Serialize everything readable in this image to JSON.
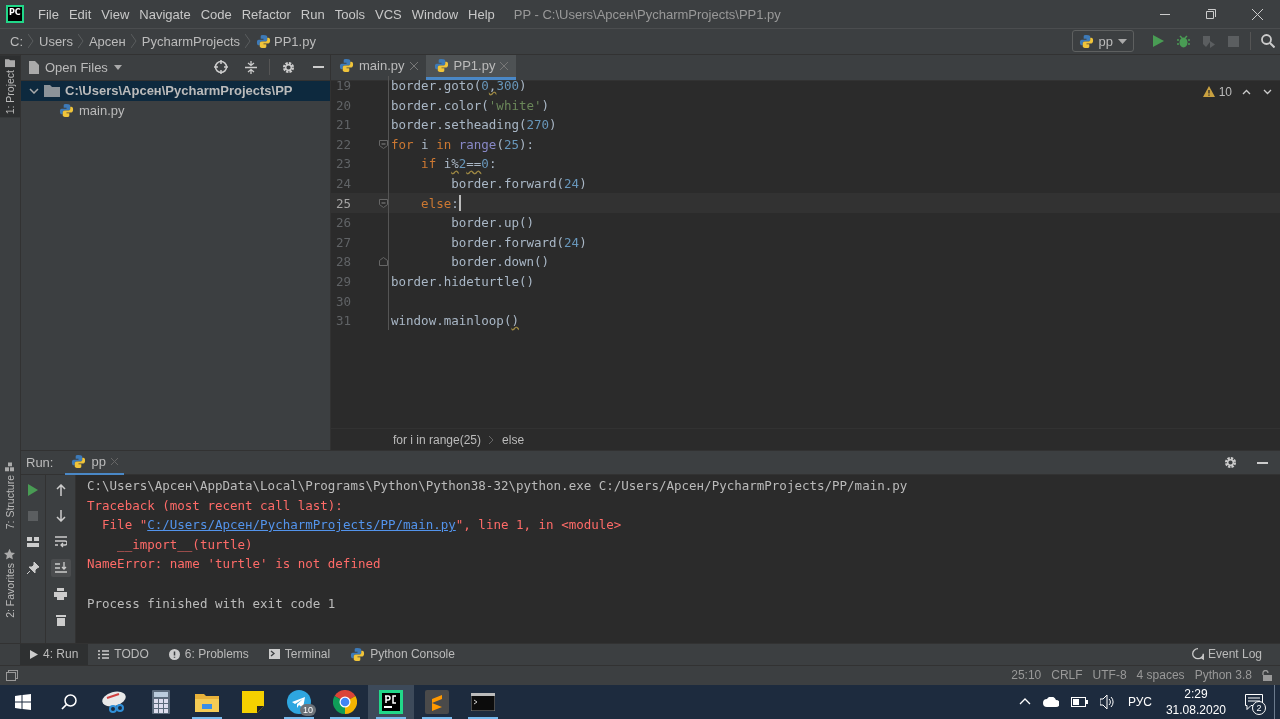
{
  "window": {
    "logo": "PC",
    "title": "PP - C:\\Users\\Арсен\\PycharmProjects\\PP1.py"
  },
  "menu": [
    "File",
    "Edit",
    "View",
    "Navigate",
    "Code",
    "Refactor",
    "Run",
    "Tools",
    "VCS",
    "Window",
    "Help"
  ],
  "breadcrumbs": [
    {
      "label": "C:",
      "kind": "drive"
    },
    {
      "label": "Users",
      "kind": "folder"
    },
    {
      "label": "Арсен",
      "kind": "folder"
    },
    {
      "label": "PycharmProjects",
      "kind": "folder"
    },
    {
      "label": "PP1.py",
      "kind": "file"
    }
  ],
  "run_config": {
    "label": "pp"
  },
  "left_stripe_top": [
    {
      "label": "1: Project",
      "selected": true
    }
  ],
  "left_stripe_bottom": [
    {
      "label": "7: Structure",
      "selected": false
    },
    {
      "label": "2: Favorites",
      "selected": false
    }
  ],
  "project_panel": {
    "view": "Open Files",
    "tree": [
      {
        "label": "C:\\Users\\Арсен\\PycharmProjects\\PP",
        "kind": "folder",
        "expanded": true,
        "selected": true,
        "children": [
          {
            "label": "main.py",
            "kind": "file",
            "selected": false
          }
        ]
      }
    ]
  },
  "editor_tabs": [
    {
      "label": "main.py",
      "selected": false
    },
    {
      "label": "PP1.py",
      "selected": true
    }
  ],
  "inspections": {
    "count": "10"
  },
  "code_lines": [
    {
      "number": "19",
      "kind": "plain",
      "current": false,
      "tokens": [
        {
          "kind": "plain",
          "text": "border.goto("
        },
        {
          "kind": "number",
          "text": "0"
        },
        {
          "kind": "plain",
          "text": ",",
          "warning": true
        },
        {
          "kind": "number",
          "text": "300"
        },
        {
          "kind": "plain",
          "text": ")"
        }
      ]
    },
    {
      "number": "20",
      "kind": "plain",
      "current": false,
      "tokens": [
        {
          "kind": "plain",
          "text": "border.color("
        },
        {
          "kind": "string",
          "text": "'white'"
        },
        {
          "kind": "plain",
          "text": ")"
        }
      ]
    },
    {
      "number": "21",
      "kind": "plain",
      "current": false,
      "tokens": [
        {
          "kind": "plain",
          "text": "border.setheading("
        },
        {
          "kind": "number",
          "text": "270"
        },
        {
          "kind": "plain",
          "text": ")"
        }
      ]
    },
    {
      "number": "22",
      "kind": "fold_start",
      "current": false,
      "tokens": [
        {
          "kind": "keyword",
          "text": "for"
        },
        {
          "kind": "plain",
          "text": " i "
        },
        {
          "kind": "keyword",
          "text": "in"
        },
        {
          "kind": "builtin",
          "text": " range"
        },
        {
          "kind": "plain",
          "text": "("
        },
        {
          "kind": "number",
          "text": "25"
        },
        {
          "kind": "plain",
          "text": "):"
        }
      ]
    },
    {
      "number": "23",
      "kind": "plain",
      "current": false,
      "tokens": [
        {
          "kind": "keyword",
          "text": "    if"
        },
        {
          "kind": "plain",
          "text": " i"
        },
        {
          "kind": "plain",
          "text": "%",
          "warning": true
        },
        {
          "kind": "number",
          "text": "2"
        },
        {
          "kind": "plain",
          "text": "==",
          "warning": true
        },
        {
          "kind": "number",
          "text": "0"
        },
        {
          "kind": "plain",
          "text": ":"
        }
      ]
    },
    {
      "number": "24",
      "kind": "plain",
      "current": false,
      "tokens": [
        {
          "kind": "plain",
          "text": "        border.forward("
        },
        {
          "kind": "number",
          "text": "24"
        },
        {
          "kind": "plain",
          "text": ")"
        }
      ]
    },
    {
      "number": "25",
      "kind": "fold_start",
      "current": true,
      "tokens": [
        {
          "kind": "keyword",
          "text": "    else"
        },
        {
          "kind": "plain",
          "text": ":"
        }
      ]
    },
    {
      "number": "26",
      "kind": "plain",
      "current": false,
      "tokens": [
        {
          "kind": "plain",
          "text": "        border.up()"
        }
      ]
    },
    {
      "number": "27",
      "kind": "plain",
      "current": false,
      "tokens": [
        {
          "kind": "plain",
          "text": "        border.forward("
        },
        {
          "kind": "number",
          "text": "24"
        },
        {
          "kind": "plain",
          "text": ")"
        }
      ]
    },
    {
      "number": "28",
      "kind": "fold_end",
      "current": false,
      "tokens": [
        {
          "kind": "plain",
          "text": "        border.down()"
        }
      ]
    },
    {
      "number": "29",
      "kind": "plain",
      "current": false,
      "tokens": [
        {
          "kind": "plain",
          "text": "border.hideturtle()"
        }
      ]
    },
    {
      "number": "30",
      "kind": "plain",
      "current": false
    },
    {
      "number": "31",
      "kind": "plain",
      "current": false,
      "tokens": [
        {
          "kind": "plain",
          "text": "window.mainloop("
        },
        {
          "kind": "plain",
          "text": ")",
          "warning": true
        }
      ]
    }
  ],
  "editor_breadcrumbs": [
    "for i in range(25)",
    "else"
  ],
  "run_panel": {
    "title": "Run:",
    "tab": "pp",
    "lines": [
      {
        "kind": "command",
        "segments": [
          {
            "text": "C:\\Users\\Арсен\\AppData\\Local\\Programs\\Python\\Python38-32\\python.exe C:/Users/Арсен/PycharmProjects/PP/main.py"
          }
        ]
      },
      {
        "kind": "error",
        "segments": [
          {
            "text": "Traceback (most recent call last):"
          }
        ]
      },
      {
        "kind": "error",
        "segments": [
          {
            "text": "  File \""
          },
          {
            "text": "C:/Users/Арсен/PycharmProjects/PP/main.py",
            "link": true
          },
          {
            "text": "\", line 1, in <module>"
          }
        ]
      },
      {
        "kind": "error",
        "segments": [
          {
            "text": "    __import__(turtle)"
          }
        ]
      },
      {
        "kind": "error",
        "segments": [
          {
            "text": "NameError: name 'turtle' is not defined"
          }
        ]
      },
      {
        "kind": "exit",
        "segments": [
          {
            "text": "Process finished with exit code 1"
          }
        ]
      }
    ]
  },
  "tool_tabs": [
    {
      "label": "4: Run",
      "kind": "run",
      "selected": true
    },
    {
      "label": "TODO",
      "kind": "todo",
      "selected": false
    },
    {
      "label": "6: Problems",
      "kind": "problems",
      "selected": false
    },
    {
      "label": "Terminal",
      "kind": "terminal",
      "selected": false
    },
    {
      "label": "Python Console",
      "kind": "console",
      "selected": false
    }
  ],
  "event_log": "Event Log",
  "status_bar": [
    "25:10",
    "CRLF",
    "UTF-8",
    "4 spaces",
    "Python 3.8"
  ],
  "taskbar": {
    "apps": [
      {
        "kind": "snipping",
        "running": false,
        "active": false
      },
      {
        "kind": "calculator",
        "running": false,
        "active": false
      },
      {
        "kind": "explorer",
        "running": true,
        "active": false
      },
      {
        "kind": "notes",
        "running": false,
        "active": false
      },
      {
        "kind": "telegram",
        "running": true,
        "active": false,
        "badge": "10"
      },
      {
        "kind": "chrome",
        "running": true,
        "active": false
      },
      {
        "kind": "pycharm",
        "running": true,
        "active": true
      },
      {
        "kind": "sublime",
        "running": true,
        "active": false
      },
      {
        "kind": "terminal",
        "running": true,
        "active": false
      }
    ],
    "tray": {
      "language": "РУС",
      "time": "2:29",
      "date": "31.08.2020",
      "notifications": "2"
    }
  }
}
